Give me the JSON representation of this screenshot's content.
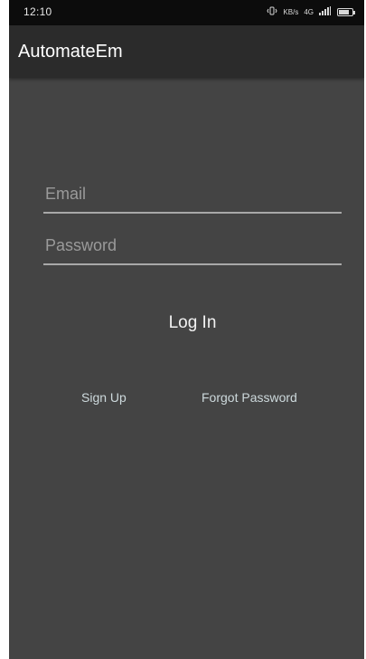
{
  "status_bar": {
    "time": "12:10",
    "icons": [
      "vibrate-icon",
      "data-speed-icon",
      "volte-icon",
      "signal-icon",
      "battery-icon"
    ],
    "data_speed_text": "KB/s",
    "network_text": "4G",
    "battery_level": 0.8
  },
  "app_bar": {
    "title": "AutomateEm"
  },
  "login_form": {
    "email_placeholder": "Email",
    "password_placeholder": "Password",
    "login_label": "Log In",
    "signup_label": "Sign Up",
    "forgot_label": "Forgot Password"
  },
  "colors": {
    "background": "#444444",
    "app_bar": "#2b2b2b",
    "status_bar": "#0c0c0c",
    "underline": "#a8a8a8",
    "link_text": "#cdd9dc"
  }
}
